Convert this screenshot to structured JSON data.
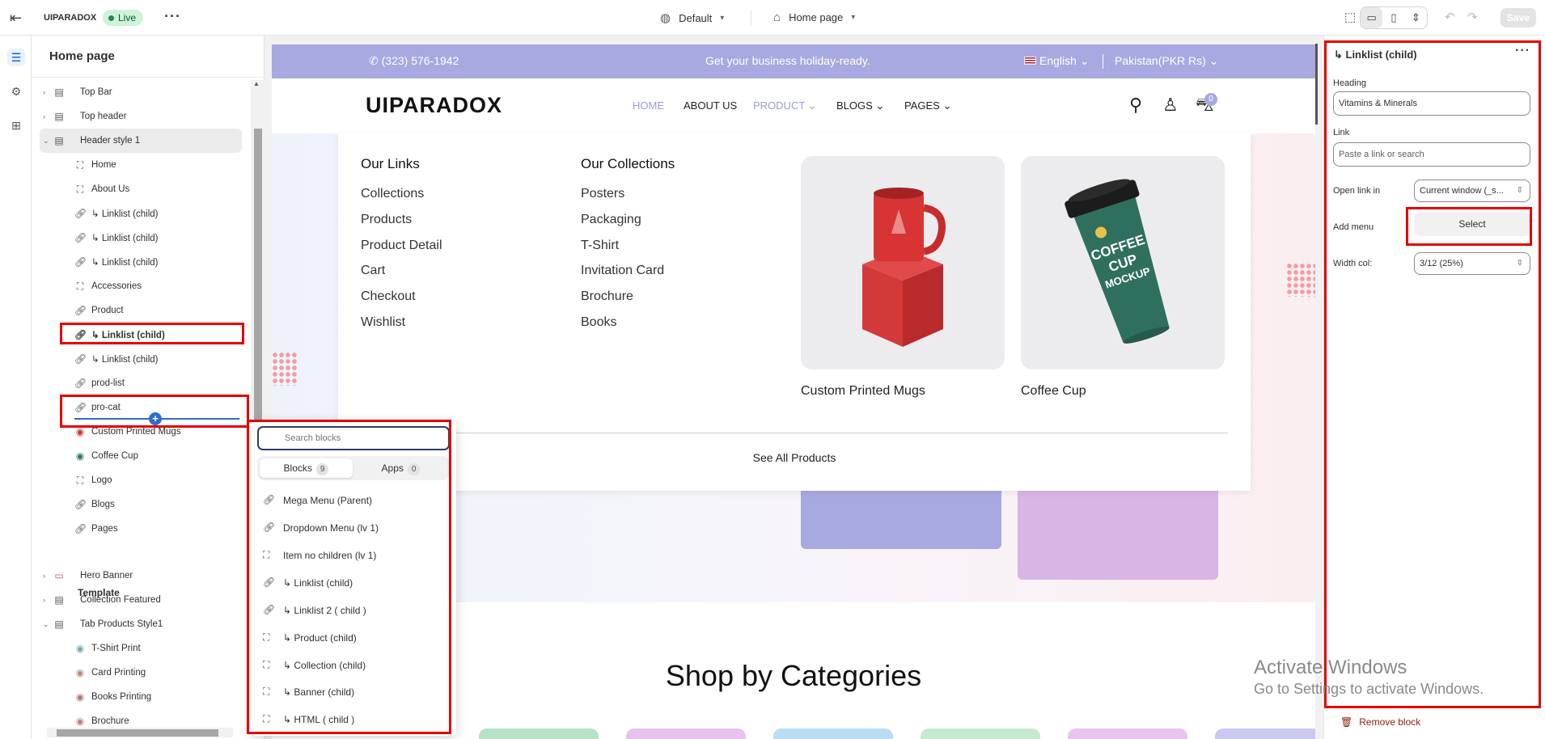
{
  "topbar": {
    "store_name": "UIPARADOX",
    "status": "Live",
    "theme_select": "Default",
    "page_select": "Home page",
    "save_label": "Save"
  },
  "left_panel": {
    "title": "Home page",
    "sections": [
      {
        "label": "Top Bar"
      },
      {
        "label": "Top header"
      },
      {
        "label": "Header style 1"
      }
    ],
    "header_blocks": [
      {
        "label": "Home",
        "icon": "block-icon"
      },
      {
        "label": "About Us",
        "icon": "block-icon"
      },
      {
        "label": "↳ Linklist (child)",
        "icon": "link-icon"
      },
      {
        "label": "↳ Linklist (child)",
        "icon": "link-icon"
      },
      {
        "label": "↳ Linklist (child)",
        "icon": "link-icon"
      },
      {
        "label": "Accessories",
        "icon": "block-icon"
      },
      {
        "label": "Product",
        "icon": "link-icon"
      },
      {
        "label": "↳ Linklist (child)",
        "icon": "link-icon"
      },
      {
        "label": "↳ Linklist (child)",
        "icon": "link-icon"
      },
      {
        "label": "prod-list",
        "icon": "link-icon"
      },
      {
        "label": "pro-cat",
        "icon": "link-icon"
      },
      {
        "label": "Custom Printed Mugs",
        "icon": "image-icon"
      },
      {
        "label": "Coffee Cup",
        "icon": "image-icon"
      },
      {
        "label": "Logo",
        "icon": "block-icon"
      },
      {
        "label": "Blogs",
        "icon": "link-icon"
      },
      {
        "label": "Pages",
        "icon": "link-icon"
      }
    ],
    "template_title": "Template",
    "template_sections": [
      {
        "label": "Hero Banner"
      },
      {
        "label": "Collection Featured"
      },
      {
        "label": "Tab Products Style1"
      }
    ],
    "template_blocks": [
      {
        "label": "T-Shirt Print"
      },
      {
        "label": "Card Printing"
      },
      {
        "label": "Books Printing"
      },
      {
        "label": "Brochure"
      }
    ]
  },
  "store": {
    "phone": "(323) 576-1942",
    "promo": "Get your business holiday-ready.",
    "language": "English",
    "currency": "Pakistan(PKR Rs)",
    "logo": "UIPARADOX",
    "nav": [
      "HOME",
      "ABOUT US",
      "PRODUCT",
      "BLOGS",
      "PAGES"
    ],
    "cart_count": "0",
    "mega": {
      "col1_title": "Our Links",
      "col1_links": [
        "Collections",
        "Products",
        "Product Detail",
        "Cart",
        "Checkout",
        "Wishlist"
      ],
      "col2_title": "Our Collections",
      "col2_links": [
        "Posters",
        "Packaging",
        "T-Shirt",
        "Invitation Card",
        "Brochure",
        "Books"
      ],
      "product1": "Custom Printed Mugs",
      "product2": "Coffee Cup",
      "cup_text_1": "COFFEE",
      "cup_text_2": "CUP",
      "cup_text_3": "MOCKUP",
      "see_all": "See All Products"
    },
    "shop_title": "Shop by Categories"
  },
  "blocks_popover": {
    "search_placeholder": "Search blocks",
    "tab_blocks": "Blocks",
    "tab_blocks_count": "9",
    "tab_apps": "Apps",
    "tab_apps_count": "0",
    "items": [
      {
        "label": "Mega Menu (Parent)",
        "icon": "link-icon"
      },
      {
        "label": "Dropdown Menu (lv 1)",
        "icon": "link-icon"
      },
      {
        "label": "Item no children (lv 1)",
        "icon": "block-icon"
      },
      {
        "label": "↳ Linklist (child)",
        "icon": "link-icon"
      },
      {
        "label": "↳ Linklist 2 ( child )",
        "icon": "link-icon"
      },
      {
        "label": "↳ Product (child)",
        "icon": "block-icon"
      },
      {
        "label": "↳ Collection (child)",
        "icon": "block-icon"
      },
      {
        "label": "↳ Banner (child)",
        "icon": "block-icon"
      },
      {
        "label": "↳ HTML ( child )",
        "icon": "block-icon"
      }
    ]
  },
  "right_panel": {
    "title": "↳ Linklist (child)",
    "heading_label": "Heading",
    "heading_value": "Vitamins & Minerals",
    "link_label": "Link",
    "link_placeholder": "Paste a link or search",
    "open_link_label": "Open link in",
    "open_link_value": "Current window (_s...",
    "add_menu_label": "Add menu",
    "add_menu_button": "Select",
    "width_label": "Width col:",
    "width_value": "3/12 (25%)",
    "remove_label": "Remove block"
  },
  "watermark": {
    "line1": "Activate Windows",
    "line2": "Go to Settings to activate Windows."
  },
  "colors": {
    "accent": "#2c6ecb",
    "highlight": "#e60000",
    "store_topbar": "#a7a9e0",
    "live_bg": "#cdf4d7"
  }
}
